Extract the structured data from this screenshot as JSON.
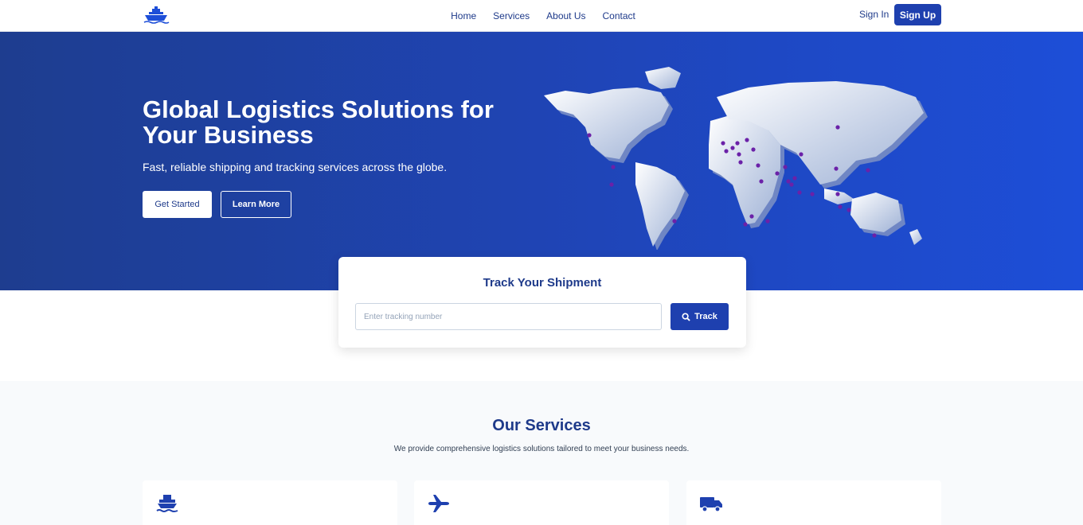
{
  "nav": {
    "logo_icon": "ship-logo-icon",
    "links": [
      "Home",
      "Services",
      "About Us",
      "Contact"
    ],
    "sign_in": "Sign In",
    "sign_up": "Sign Up"
  },
  "hero": {
    "title": "Global Logistics Solutions for Your Business",
    "subtitle": "Fast, reliable shipping and tracking services across the globe.",
    "primary_button": "Get Started",
    "secondary_button": "Learn More",
    "map_icon": "world-map-icon"
  },
  "tracking": {
    "title": "Track Your Shipment",
    "placeholder": "Enter tracking number",
    "value": "",
    "button": "Track",
    "button_icon": "search-icon"
  },
  "services": {
    "title": "Our Services",
    "subtitle": "We provide comprehensive logistics solutions tailored to meet your business needs.",
    "cards": [
      {
        "icon": "ship-icon"
      },
      {
        "icon": "plane-icon"
      },
      {
        "icon": "truck-icon"
      }
    ]
  },
  "colors": {
    "brand": "#1e40af",
    "heading": "#1e3a8a",
    "hero_gradient_start": "#1e3d8f",
    "hero_gradient_end": "#1d4ed8",
    "marker": "#6b21a8"
  }
}
